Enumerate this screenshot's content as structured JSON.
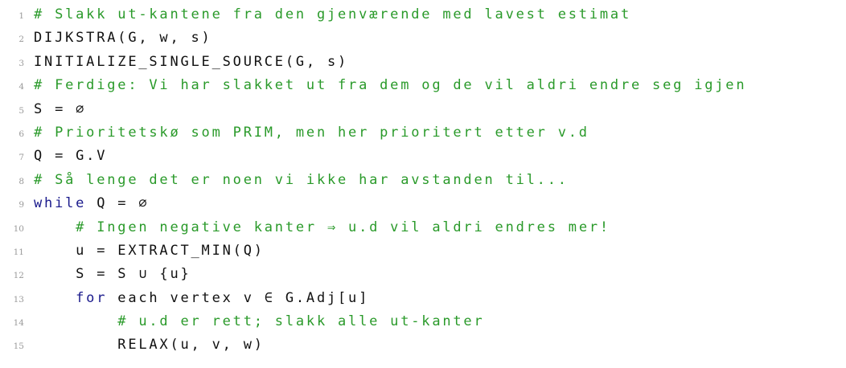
{
  "lines": [
    {
      "n": "1",
      "indent": "",
      "kw": "",
      "text": "",
      "comment": "# Slakk ut-kantene fra den gjenværende med lavest estimat"
    },
    {
      "n": "2",
      "indent": "",
      "kw": "",
      "text": "DIJKSTRA(G, w, s)",
      "comment": ""
    },
    {
      "n": "3",
      "indent": "",
      "kw": "",
      "text": "INITIALIZE_SINGLE_SOURCE(G, s)",
      "comment": ""
    },
    {
      "n": "4",
      "indent": "",
      "kw": "",
      "text": "",
      "comment": "# Ferdige: Vi har slakket ut fra dem og de vil aldri endre seg igjen"
    },
    {
      "n": "5",
      "indent": "",
      "kw": "",
      "text": "S = ∅",
      "comment": ""
    },
    {
      "n": "6",
      "indent": "",
      "kw": "",
      "text": "",
      "comment": "# Prioritetskø som PRIM, men her prioritert etter v.d"
    },
    {
      "n": "7",
      "indent": "",
      "kw": "",
      "text": "Q = G.V",
      "comment": ""
    },
    {
      "n": "8",
      "indent": "",
      "kw": "",
      "text": "",
      "comment": "# Så lenge det er noen vi ikke har avstanden til..."
    },
    {
      "n": "9",
      "indent": "",
      "kw": "while",
      "text": " Q = ∅",
      "comment": ""
    },
    {
      "n": "10",
      "indent": "    ",
      "kw": "",
      "text": "",
      "comment": "# Ingen negative kanter ⇒ u.d vil aldri endres mer!"
    },
    {
      "n": "11",
      "indent": "    ",
      "kw": "",
      "text": "u = EXTRACT_MIN(Q)",
      "comment": ""
    },
    {
      "n": "12",
      "indent": "    ",
      "kw": "",
      "text": "S = S ∪ {u}",
      "comment": ""
    },
    {
      "n": "13",
      "indent": "    ",
      "kw": "for",
      "text": " each vertex v ∈ G.Adj[u]",
      "comment": ""
    },
    {
      "n": "14",
      "indent": "        ",
      "kw": "",
      "text": "",
      "comment": "# u.d er rett; slakk alle ut-kanter"
    },
    {
      "n": "15",
      "indent": "        ",
      "kw": "",
      "text": "RELAX(u, v, w)",
      "comment": ""
    }
  ]
}
